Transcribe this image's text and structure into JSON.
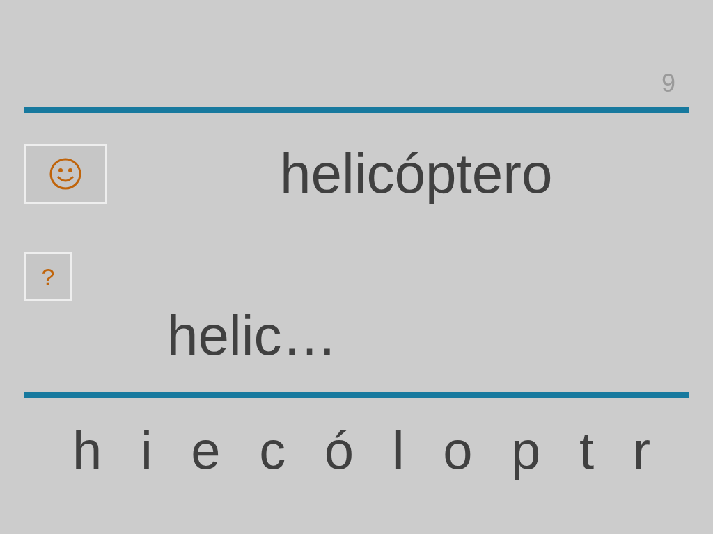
{
  "page_number": "9",
  "feedback_button": {
    "kind": "smiley"
  },
  "word": "helicóptero",
  "hint_button": {
    "label": "?"
  },
  "answer": "helic…",
  "letters": [
    "h",
    "i",
    "e",
    "c",
    "ó",
    "l",
    "o",
    "p",
    "t",
    "r"
  ]
}
